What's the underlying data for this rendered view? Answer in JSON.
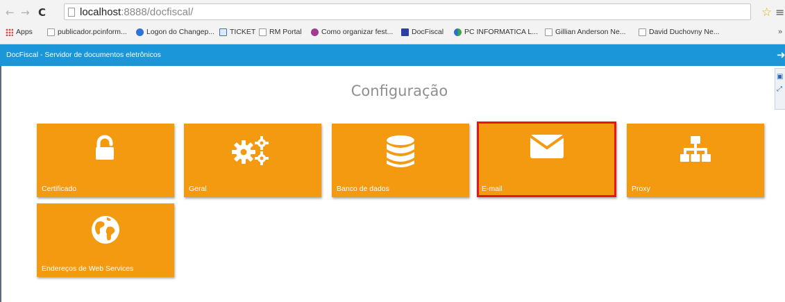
{
  "browser": {
    "url_host": "localhost",
    "url_rest": ":8888/docfiscal/",
    "bookmarks": [
      {
        "label": "Apps",
        "icon": "apps-grid-icon"
      },
      {
        "label": "publicador.pcinform...",
        "icon": "page-icon"
      },
      {
        "label": "Logon do Changep...",
        "icon": "google-icon"
      },
      {
        "label": "TICKET",
        "icon": "ticket-icon"
      },
      {
        "label": "RM Portal",
        "icon": "page-icon"
      },
      {
        "label": "Como organizar fest...",
        "icon": "purple-circle-icon"
      },
      {
        "label": "DocFiscal",
        "icon": "docfiscal-icon"
      },
      {
        "label": "PC INFORMATICA L...",
        "icon": "pc-info-icon"
      },
      {
        "label": "Gillian Anderson Ne...",
        "icon": "page-icon"
      },
      {
        "label": "David Duchovny Ne...",
        "icon": "page-icon"
      }
    ],
    "more_label": "»"
  },
  "header": {
    "title": "DocFiscal - Servidor de documentos eletrônicos",
    "background": "#1a96d9"
  },
  "page": {
    "title": "Configuração"
  },
  "tiles": [
    {
      "label": "Certificado",
      "icon": "unlock-icon",
      "selected": false
    },
    {
      "label": "Geral",
      "icon": "gears-icon",
      "selected": false
    },
    {
      "label": "Banco de dados",
      "icon": "database-icon",
      "selected": false
    },
    {
      "label": "E-mail",
      "icon": "envelope-icon",
      "selected": true
    },
    {
      "label": "Proxy",
      "icon": "sitemap-icon",
      "selected": false
    },
    {
      "label": "Endereços de Web Services",
      "icon": "globe-icon",
      "selected": false
    }
  ],
  "colors": {
    "tile": "#f49a10",
    "selected_border": "#e81515"
  }
}
